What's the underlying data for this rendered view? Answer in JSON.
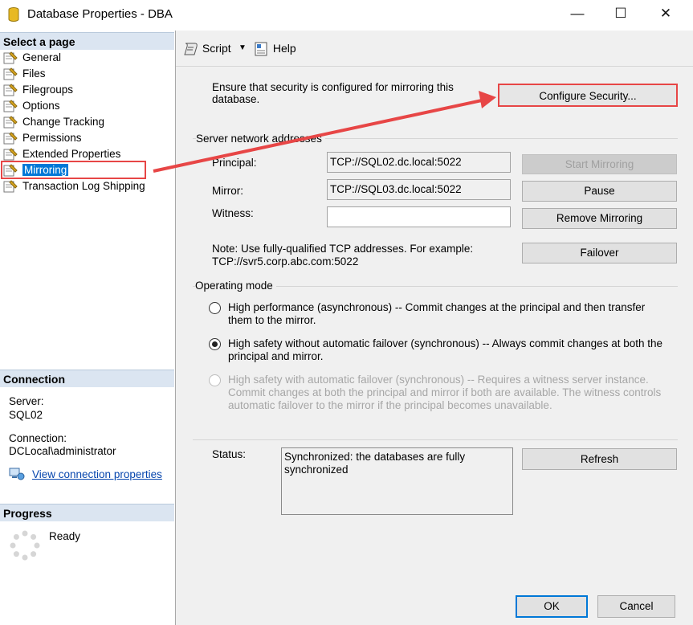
{
  "window": {
    "title": "Database Properties - DBA",
    "minimize": "—",
    "maximize": "☐",
    "close": "✕"
  },
  "sidebar": {
    "select_page_header": "Select a page",
    "pages": [
      {
        "label": "General"
      },
      {
        "label": "Files"
      },
      {
        "label": "Filegroups"
      },
      {
        "label": "Options"
      },
      {
        "label": "Change Tracking"
      },
      {
        "label": "Permissions"
      },
      {
        "label": "Extended Properties"
      },
      {
        "label": "Mirroring",
        "selected": true
      },
      {
        "label": "Transaction Log Shipping"
      }
    ],
    "connection_header": "Connection",
    "server_label": "Server:",
    "server_value": "SQL02",
    "connection_label": "Connection:",
    "connection_value": "DCLocal\\administrator",
    "view_connection_link": "View connection properties",
    "progress_header": "Progress",
    "progress_status": "Ready"
  },
  "toolbar": {
    "script_label": "Script",
    "help_label": "Help"
  },
  "mirroring": {
    "security_note": "Ensure that security is configured for mirroring this database.",
    "configure_security_button": "Configure Security...",
    "network_group_label": "Server network addresses",
    "principal_label": "Principal:",
    "principal_value": "TCP://SQL02.dc.local:5022",
    "mirror_label": "Mirror:",
    "mirror_value": "TCP://SQL03.dc.local:5022",
    "witness_label": "Witness:",
    "witness_value": "",
    "start_mirroring_button": "Start Mirroring",
    "pause_button": "Pause",
    "remove_mirroring_button": "Remove Mirroring",
    "failover_button": "Failover",
    "address_note": "Note: Use fully-qualified TCP addresses. For example: TCP://svr5.corp.abc.com:5022",
    "operating_mode_label": "Operating mode",
    "modes": [
      {
        "label": "High performance (asynchronous) -- Commit changes at the principal and then transfer them to the mirror.",
        "checked": false,
        "enabled": true
      },
      {
        "label": "High safety without automatic failover (synchronous) -- Always commit changes at both the principal and mirror.",
        "checked": true,
        "enabled": true
      },
      {
        "label": "High safety with automatic failover (synchronous) -- Requires a witness server instance. Commit changes at both the principal and mirror if both are available. The witness controls automatic failover to the mirror if the principal becomes unavailable.",
        "checked": false,
        "enabled": false
      }
    ],
    "status_label": "Status:",
    "status_value": "Synchronized: the databases are fully synchronized",
    "refresh_button": "Refresh"
  },
  "footer": {
    "ok_button": "OK",
    "cancel_button": "Cancel"
  },
  "colors": {
    "selection": "#0078d7",
    "annotation": "#e74646",
    "section_header": "#dbe5f1"
  }
}
